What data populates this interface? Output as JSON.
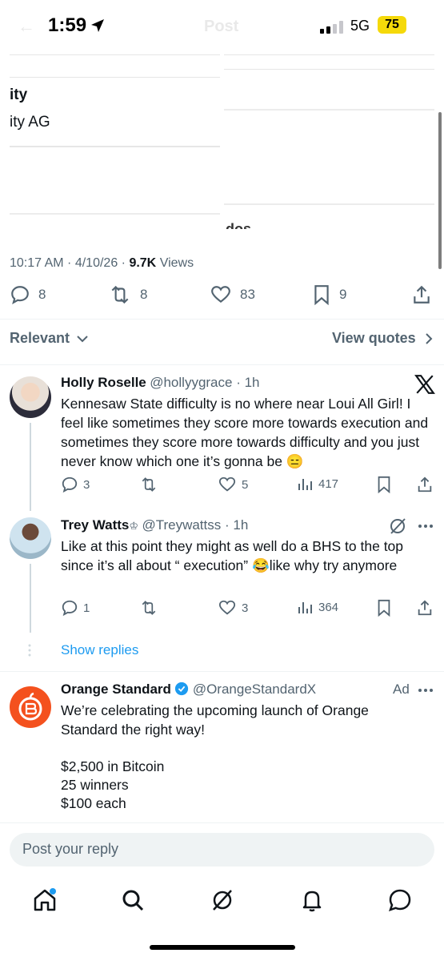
{
  "status_bar": {
    "time": "1:59",
    "network": "5G",
    "battery": "75"
  },
  "header": {
    "title_ghost": "Post",
    "back_ghost": "←"
  },
  "media": {
    "text_line1": "ity",
    "text_line2": "ity AG",
    "cut_text": "dos"
  },
  "post_meta": {
    "time": "10:17 AM",
    "date": "4/10/26",
    "views_count": "9.7K",
    "views_label": "Views"
  },
  "post_actions": {
    "replies": "8",
    "reposts": "8",
    "likes": "83",
    "bookmarks": "9"
  },
  "sort": {
    "label": "Relevant",
    "view_quotes": "View quotes"
  },
  "replies": [
    {
      "name": "Holly Roselle",
      "handle": "@hollyygrace",
      "time": "1h",
      "text": "Kennesaw State difficulty is no where near Loui All Girl! I feel like sometimes they score more towards execution and sometimes  they score more towards difficulty and you just never know which one it’s gonna be 😑",
      "reply_count": "3",
      "like_count": "5",
      "views": "417"
    },
    {
      "name": "Trey Watts",
      "name_badge": "♔",
      "handle": "@Treywattss",
      "time": "1h",
      "text": "Like at this point they might as well do a BHS to the top since it’s all about “ execution” 😂like why try anymore",
      "reply_count": "1",
      "like_count": "3",
      "views": "364"
    }
  ],
  "show_replies": "Show replies",
  "ad": {
    "name": "Orange Standard",
    "handle": "@OrangeStandardX",
    "label": "Ad",
    "text_line1": "We’re celebrating the upcoming launch of Orange Standard the right way!",
    "text_line2": "$2,500 in Bitcoin",
    "text_line3": "25 winners",
    "text_line4": "$100 each"
  },
  "reply_input": {
    "placeholder": "Post your reply"
  },
  "colors": {
    "accent": "#1d9bf0",
    "ad_brand": "#f4511e",
    "battery": "#f5d90a"
  },
  "icons": [
    "location-arrow-icon",
    "signal-icon",
    "reply-icon",
    "repost-icon",
    "like-icon",
    "bookmark-icon",
    "share-icon",
    "views-icon",
    "x-logo-icon",
    "grok-icon",
    "more-icon",
    "verified-icon",
    "home-icon",
    "search-icon",
    "notifications-icon",
    "messages-icon"
  ]
}
